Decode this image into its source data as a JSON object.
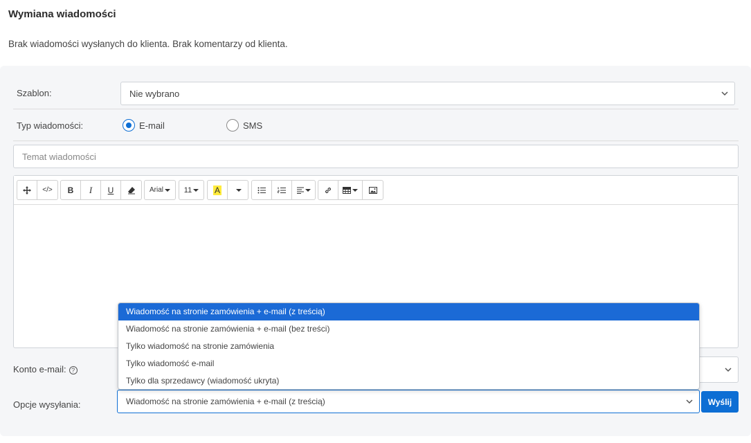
{
  "header": {
    "title": "Wymiana wiadomości",
    "info": "Brak wiadomości wysłanych do klienta. Brak komentarzy od klienta."
  },
  "template": {
    "label": "Szablon:",
    "value": "Nie wybrano"
  },
  "message_type": {
    "label": "Typ wiadomości:",
    "options": [
      "E-mail",
      "SMS"
    ],
    "selected": "E-mail"
  },
  "subject": {
    "placeholder": "Temat wiadomości",
    "value": ""
  },
  "editor_toolbar": {
    "font": "Arial",
    "size": "11",
    "buttons": [
      "move",
      "code",
      "bold",
      "italic",
      "underline",
      "eraser",
      "font",
      "size",
      "highlight",
      "color-dropdown",
      "unordered-list",
      "ordered-list",
      "align",
      "link",
      "table",
      "image"
    ]
  },
  "email_account": {
    "label": "Konto e-mail:",
    "help": "?"
  },
  "send_options": {
    "label": "Opcje wysyłania:",
    "value": "Wiadomość na stronie zamówienia + e-mail (z treścią)",
    "options": [
      "Wiadomość na stronie zamówienia + e-mail (z treścią)",
      "Wiadomość na stronie zamówienia + e-mail (bez treści)",
      "Tylko wiadomość na stronie zamówienia",
      "Tylko wiadomość e-mail",
      "Tylko dla sprzedawcy (wiadomość ukryta)"
    ],
    "selected_index": 0
  },
  "send_button": "Wyślij",
  "colors": {
    "accent": "#0d6ed4",
    "highlight": "#ffeb3b"
  }
}
